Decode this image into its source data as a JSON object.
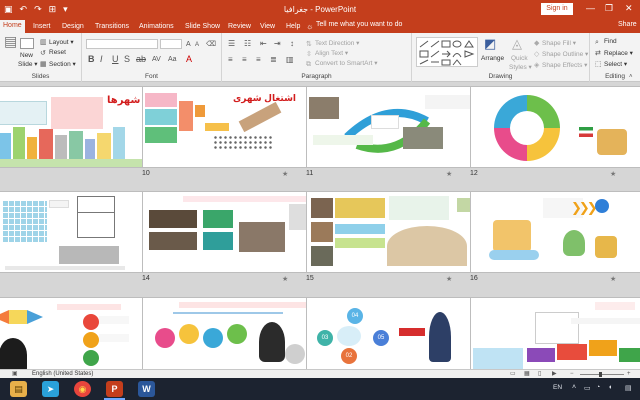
{
  "window": {
    "title": "جغرافیا - PowerPoint",
    "signin_label": "Sign in",
    "minimize_glyph": "—",
    "restore_glyph": "❐",
    "close_glyph": "✕"
  },
  "quick_access": {
    "save_glyph": "▣",
    "undo_glyph": "↶",
    "redo_glyph": "↷",
    "start_glyph": "⊞",
    "more_glyph": "▾"
  },
  "tabs": [
    "Home",
    "Insert",
    "Design",
    "Transitions",
    "Animations",
    "Slide Show",
    "Review",
    "View",
    "Help"
  ],
  "active_tab": "Home",
  "tell_me": "Tell me what you want to do",
  "share_label": "Share",
  "ribbon": {
    "groups": {
      "slides": "Slides",
      "font": "Font",
      "paragraph": "Paragraph",
      "drawing": "Drawing",
      "editing": "Editing"
    },
    "slides": {
      "new_slide": "New",
      "new_slide_2": "Slide ▾",
      "layout": "Layout ▾",
      "reset": "Reset",
      "section": "Section ▾"
    },
    "paragraph": {
      "text_direction": "Text Direction ▾",
      "align_text": "Align Text ▾",
      "convert_smartart": "Convert to SmartArt ▾"
    },
    "drawing": {
      "arrange": "Arrange",
      "quick_styles": "Quick",
      "quick_styles_2": "Styles ▾",
      "shape_fill": "Shape Fill ▾",
      "shape_outline": "Shape Outline ▾",
      "shape_effects": "Shape Effects ▾"
    },
    "editing": {
      "find": "Find",
      "replace": "Replace ▾",
      "select": "Select ▾"
    },
    "font_glyphs": {
      "bold": "B",
      "italic": "I",
      "underline": "U",
      "strike": "S"
    }
  },
  "slides": [
    {
      "number": "",
      "title": "شهرها"
    },
    {
      "number": "10",
      "title": "اشتغال شهری"
    },
    {
      "number": "11",
      "title": ""
    },
    {
      "number": "12",
      "title": ""
    },
    {
      "number": "",
      "title": ""
    },
    {
      "number": "14",
      "title": ""
    },
    {
      "number": "15",
      "title": ""
    },
    {
      "number": "16",
      "title": ""
    },
    {
      "number": "",
      "title": ""
    },
    {
      "number": "",
      "title": ""
    },
    {
      "number": "",
      "title": ""
    },
    {
      "number": "",
      "title": ""
    }
  ],
  "diagram_labels": {
    "d4": "04",
    "d3": "03",
    "d5": "05",
    "d2": "02"
  },
  "status": {
    "language": "English (United States)"
  },
  "taskbar": {
    "tray_lang": "EN",
    "icons": {
      "files": "▤",
      "telegram": "➤",
      "chrome": "◉",
      "powerpoint": "P",
      "word": "W"
    }
  },
  "colors": {
    "accent": "#c43e1c",
    "ribbon_bg": "#f3f3f3",
    "taskbar": "#1c2330"
  }
}
